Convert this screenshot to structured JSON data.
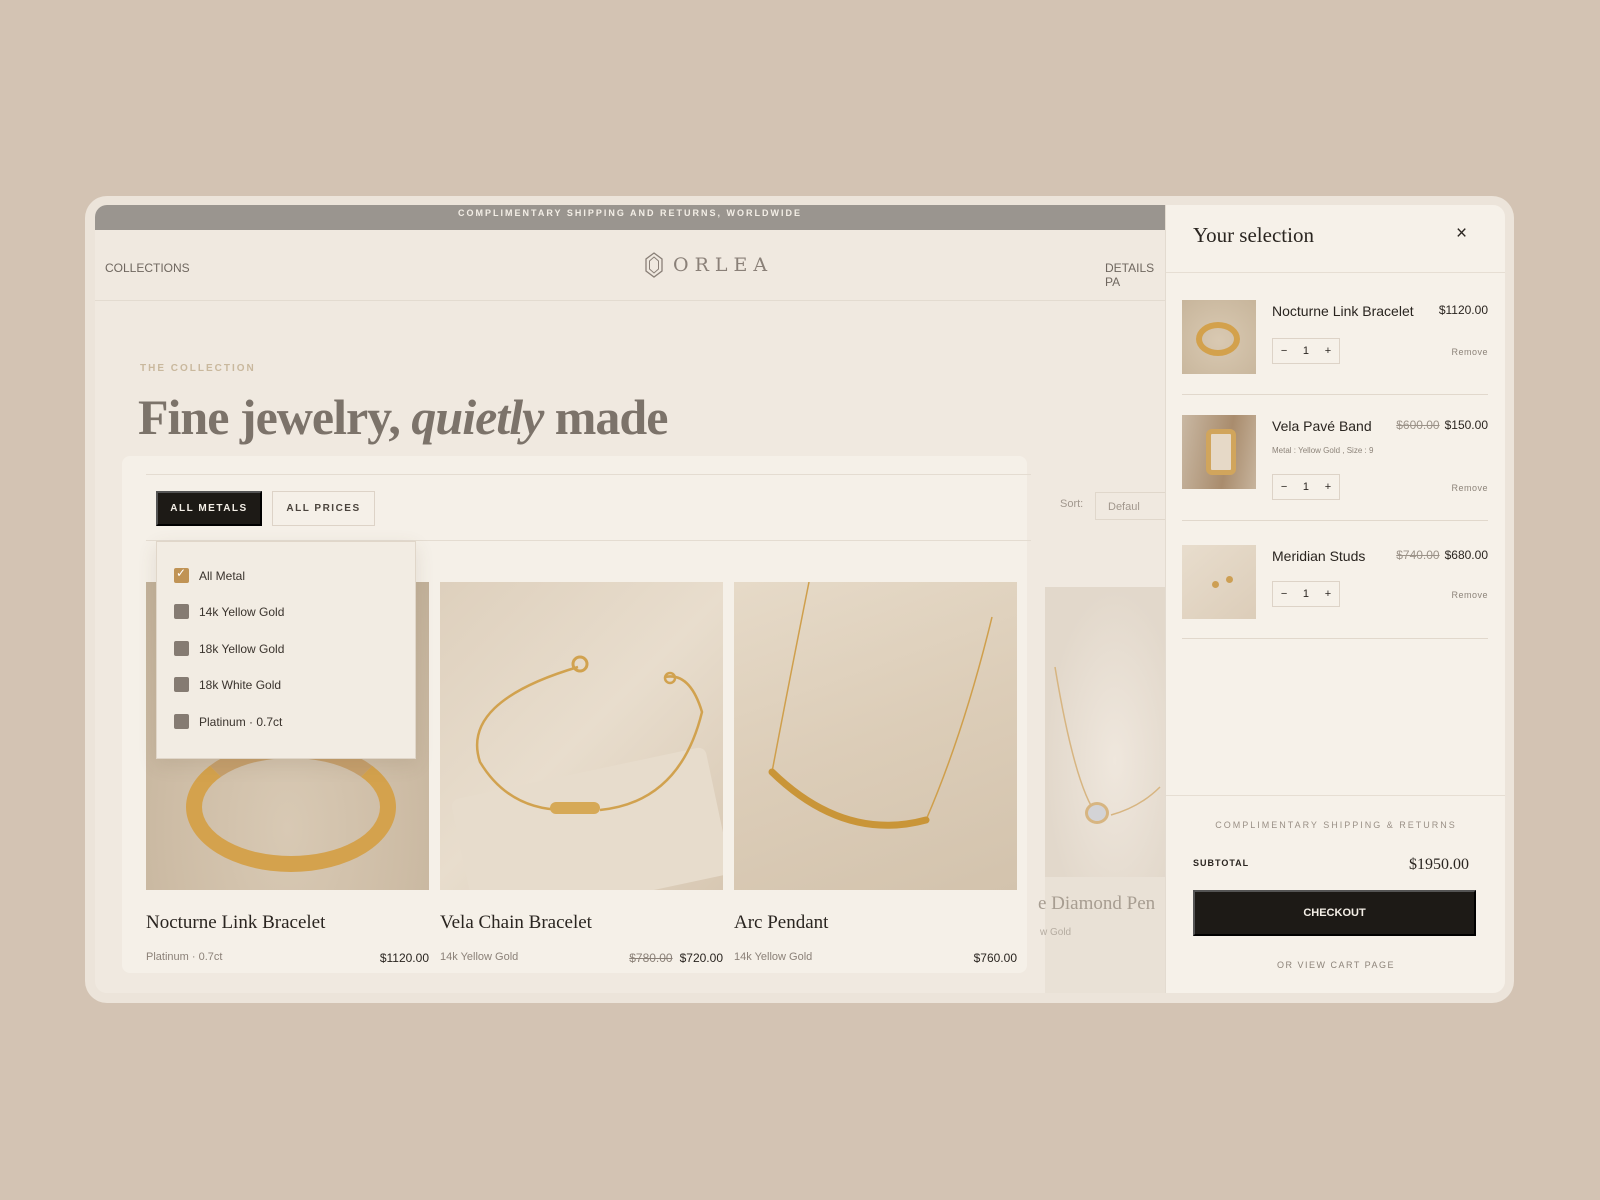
{
  "announcement": "COMPLIMENTARY SHIPPING AND RETURNS, WORLDWIDE",
  "nav": {
    "left": "COLLECTIONS",
    "right": "DETAILS PA"
  },
  "logo": "ORLEA",
  "hero": {
    "eyebrow": "THE COLLECTION",
    "headline_start": "Fine jewelry, ",
    "headline_em": "quietly",
    "headline_end": " made"
  },
  "filters": {
    "metals": "ALL METALS",
    "prices": "ALL PRICES"
  },
  "sort": {
    "label": "Sort:",
    "value": "Defaul"
  },
  "metal_options": [
    {
      "label": "All Metal",
      "checked": true
    },
    {
      "label": "14k Yellow Gold",
      "checked": false
    },
    {
      "label": "18k Yellow Gold",
      "checked": false
    },
    {
      "label": "18k White Gold",
      "checked": false
    },
    {
      "label": "Platinum · 0.7ct",
      "checked": false
    }
  ],
  "products": [
    {
      "name": "Nocturne Link Bracelet",
      "meta": "Platinum · 0.7ct",
      "old_price": "",
      "price": "$1120.00"
    },
    {
      "name": "Vela Chain Bracelet",
      "meta": "14k Yellow Gold",
      "old_price": "$780.00",
      "price": "$720.00"
    },
    {
      "name": "Arc Pendant",
      "meta": "14k Yellow Gold",
      "old_price": "",
      "price": "$760.00"
    },
    {
      "name": "e Diamond Pen",
      "meta": "w Gold",
      "old_price": "",
      "price": ""
    }
  ],
  "cart": {
    "title": "Your selection",
    "close": "×",
    "items": [
      {
        "name": "Nocturne Link Bracelet",
        "old_price": "",
        "price": "$1120.00",
        "meta": "",
        "qty": "1",
        "remove": "Remove"
      },
      {
        "name": "Vela Pavé Band",
        "old_price": "$600.00",
        "price": "$150.00",
        "meta": "Metal : Yellow Gold ,   Size : 9",
        "qty": "1",
        "remove": "Remove"
      },
      {
        "name": "Meridian Studs",
        "old_price": "$740.00",
        "price": "$680.00",
        "meta": "",
        "qty": "1",
        "remove": "Remove"
      }
    ],
    "minus": "−",
    "plus": "+",
    "shipping_note": "COMPLIMENTARY SHIPPING & RETURNS",
    "subtotal_label": "SUBTOTAL",
    "subtotal_value": "$1950.00",
    "checkout": "CHECKOUT",
    "view_cart": "OR VIEW CART PAGE"
  },
  "colors": {
    "accent": "#c09355",
    "dark": "#1d1a16",
    "background": "#d3c3b3",
    "panel": "#f5f0e8"
  }
}
